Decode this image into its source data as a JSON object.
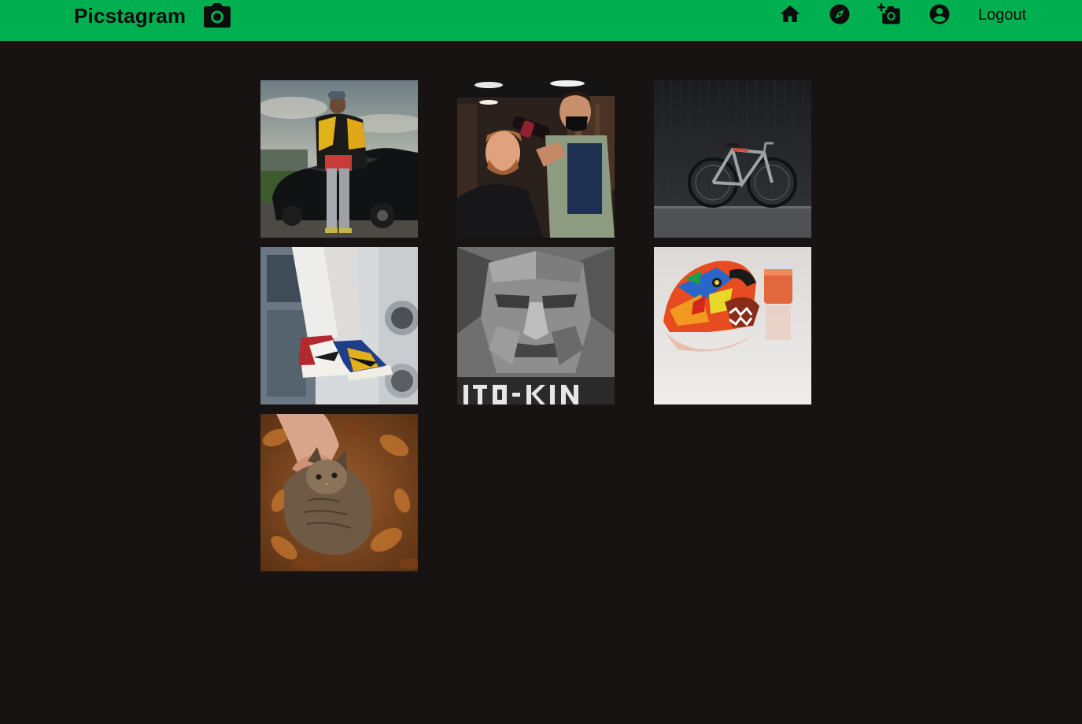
{
  "navbar": {
    "brand": "Picstagram",
    "brand_icon": "camera-icon",
    "background_color": "#00b050",
    "icons": [
      "home-icon",
      "explore-icon",
      "add-photo-icon",
      "account-icon"
    ],
    "logout_label": "Logout"
  },
  "feed": {
    "background_color": "#171313",
    "posts": [
      {
        "subject": "person-with-car"
      },
      {
        "subject": "barber"
      },
      {
        "subject": "bicycle"
      },
      {
        "subject": "sneakers"
      },
      {
        "subject": "stone-face"
      },
      {
        "subject": "beaded-jaguar"
      },
      {
        "subject": "cat-in-leaves"
      }
    ]
  }
}
